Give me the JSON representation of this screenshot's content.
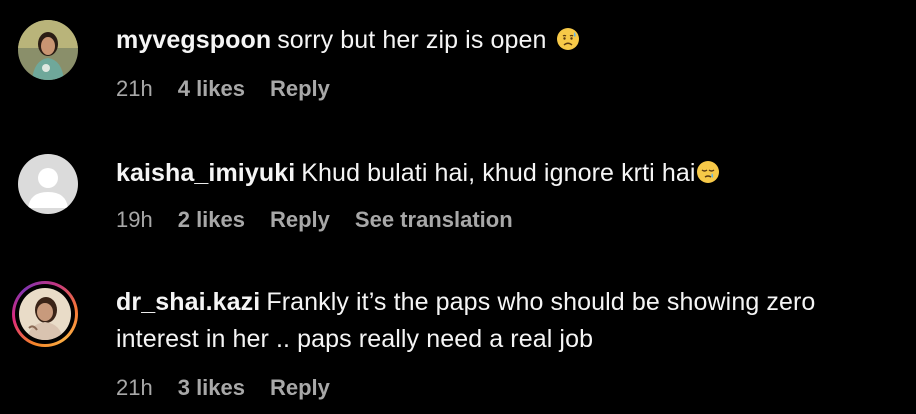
{
  "comments": [
    {
      "username": "myvegspoon",
      "text": "sorry but her zip is open",
      "emoji": "sad-sweat-emoji",
      "time": "21h",
      "likes": "4 likes",
      "reply": "Reply"
    },
    {
      "username": "kaisha_imiyuki",
      "text": "Khud bulati hai, khud ignore krti hai",
      "emoji": "sleepy-emoji",
      "time": "19h",
      "likes": "2 likes",
      "reply": "Reply",
      "translate": "See translation"
    },
    {
      "username": "dr_shai.kazi",
      "text": "Frankly it’s the paps who should be showing zero interest in her .. paps really need a real job",
      "time": "21h",
      "likes": "3 likes",
      "reply": "Reply",
      "story_ring": true
    }
  ],
  "colors": {
    "background": "#000000",
    "text": "#f5f5f5",
    "meta": "#a8a8a8",
    "default_avatar_bg": "#dbdbdb",
    "default_avatar_fg": "#ffffff"
  }
}
